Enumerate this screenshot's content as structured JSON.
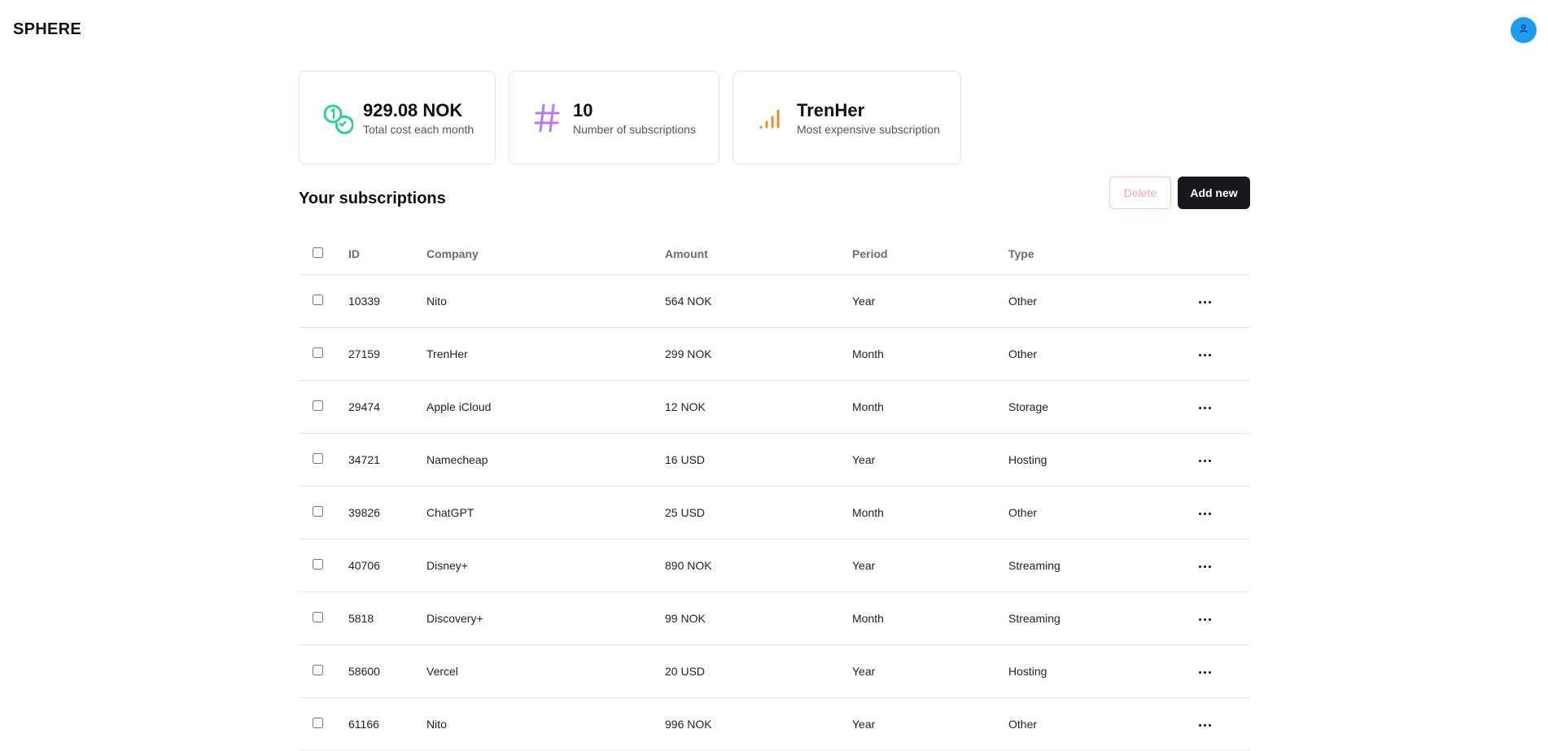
{
  "header": {
    "brand": "SPHERE",
    "avatar_icon": "user-icon",
    "avatar_color": "#1f9cf0"
  },
  "stats": [
    {
      "value": "929.08 NOK",
      "label": "Total cost each month",
      "icon": "coins-icon",
      "color": "#2ccf9b"
    },
    {
      "value": "10",
      "label": "Number of subscriptions",
      "icon": "hash-icon",
      "color": "#b57bef"
    },
    {
      "value": "TrenHer",
      "label": "Most expensive subscription",
      "icon": "signal-bars-icon",
      "color": "#f08a2c"
    }
  ],
  "subscriptions": {
    "title": "Your subscriptions",
    "delete_label": "Delete",
    "add_label": "Add new",
    "columns": [
      "ID",
      "Company",
      "Amount",
      "Period",
      "Type"
    ],
    "rows": [
      {
        "id": "10339",
        "company": "Nito",
        "amount": "564 NOK",
        "period": "Year",
        "type": "Other"
      },
      {
        "id": "27159",
        "company": "TrenHer",
        "amount": "299 NOK",
        "period": "Month",
        "type": "Other"
      },
      {
        "id": "29474",
        "company": "Apple iCloud",
        "amount": "12 NOK",
        "period": "Month",
        "type": "Storage"
      },
      {
        "id": "34721",
        "company": "Namecheap",
        "amount": "16 USD",
        "period": "Year",
        "type": "Hosting"
      },
      {
        "id": "39826",
        "company": "ChatGPT",
        "amount": "25 USD",
        "period": "Month",
        "type": "Other"
      },
      {
        "id": "40706",
        "company": "Disney+",
        "amount": "890 NOK",
        "period": "Year",
        "type": "Streaming"
      },
      {
        "id": "5818",
        "company": "Discovery+",
        "amount": "99 NOK",
        "period": "Month",
        "type": "Streaming"
      },
      {
        "id": "58600",
        "company": "Vercel",
        "amount": "20 USD",
        "period": "Year",
        "type": "Hosting"
      },
      {
        "id": "61166",
        "company": "Nito",
        "amount": "996 NOK",
        "period": "Year",
        "type": "Other"
      }
    ]
  }
}
